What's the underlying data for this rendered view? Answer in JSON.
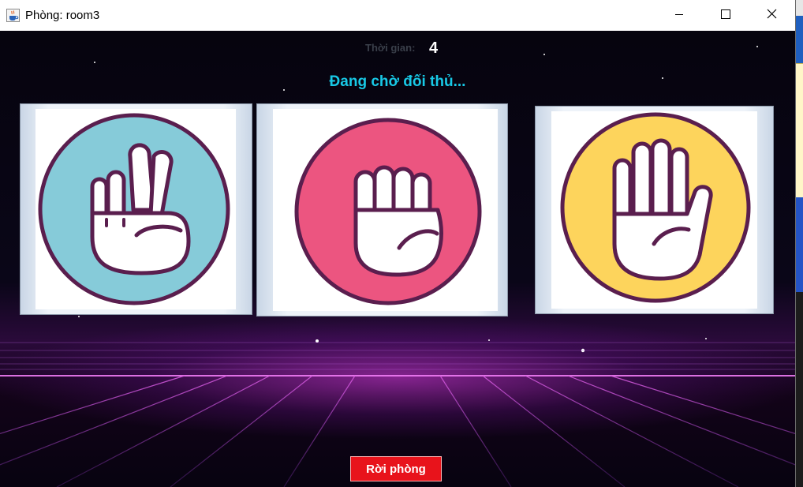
{
  "window": {
    "title": "Phòng: room3",
    "icons": {
      "app": "java-cup-icon",
      "minimize": "minimize-icon",
      "maximize": "maximize-icon",
      "close": "close-icon"
    }
  },
  "game": {
    "timer_label": "Thời gian:",
    "timer_value": "4",
    "status": "Đang chờ đối thủ...",
    "choices": [
      {
        "icon": "scissors-hand-icon",
        "color": "#86cbd9"
      },
      {
        "icon": "rock-fist-icon",
        "color": "#ec5580"
      },
      {
        "icon": "paper-hand-icon",
        "color": "#fdd45c"
      }
    ],
    "leave_label": "Rời phòng"
  },
  "colors": {
    "status_text": "#18c9e6",
    "leave_button": "#e8131b",
    "outline": "#5a1e4e"
  }
}
